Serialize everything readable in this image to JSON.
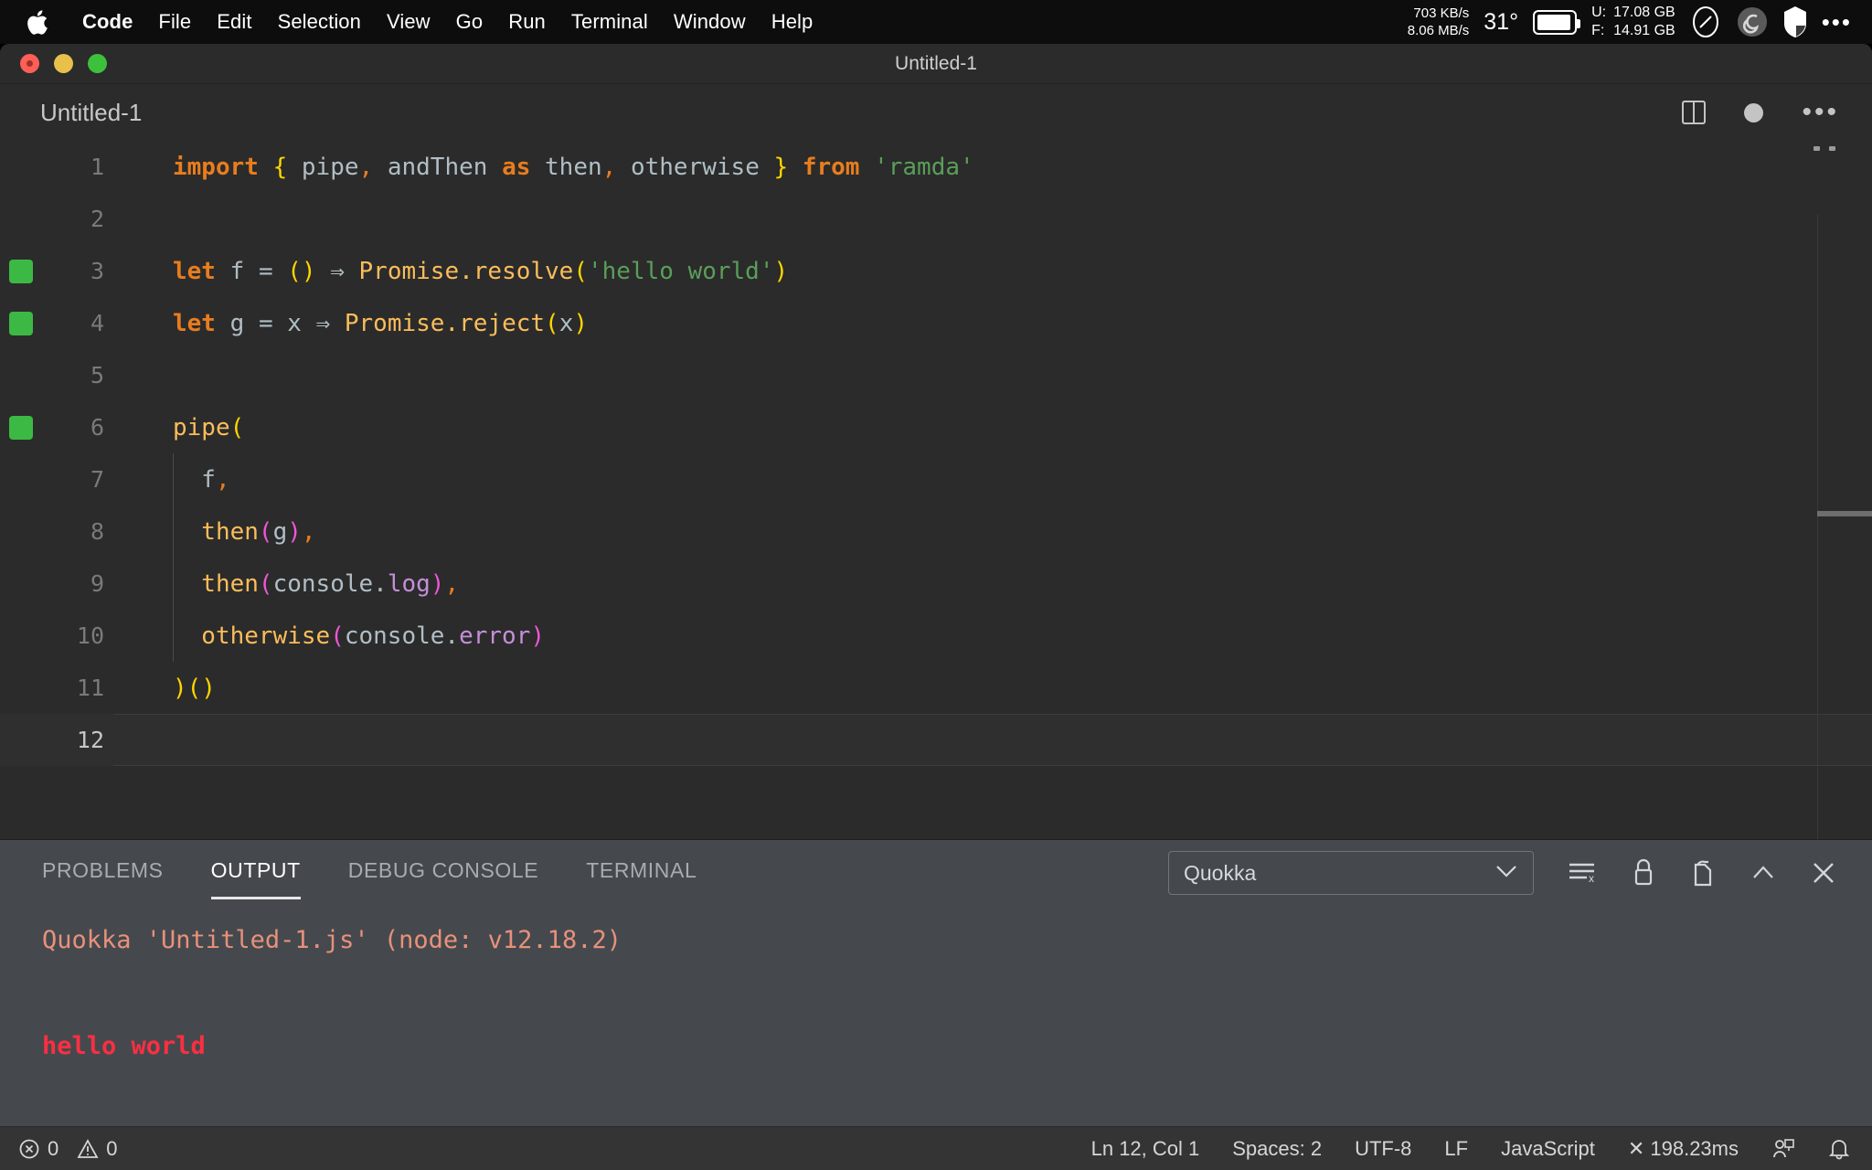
{
  "menubar": {
    "apple_icon": "apple-logo-icon",
    "items": [
      {
        "label": "Code",
        "bold": true
      },
      {
        "label": "File",
        "bold": false
      },
      {
        "label": "Edit",
        "bold": false
      },
      {
        "label": "Selection",
        "bold": false
      },
      {
        "label": "View",
        "bold": false
      },
      {
        "label": "Go",
        "bold": false
      },
      {
        "label": "Run",
        "bold": false
      },
      {
        "label": "Terminal",
        "bold": false
      },
      {
        "label": "Window",
        "bold": false
      },
      {
        "label": "Help",
        "bold": false
      }
    ],
    "status": {
      "net_up": "703 KB/s",
      "net_down": "8.06 MB/s",
      "temperature": "31°",
      "battery_icon": "battery-icon",
      "mem_used_label": "U:",
      "mem_used_value": "17.08 GB",
      "mem_free_label": "F:",
      "mem_free_value": "14.91 GB",
      "gauge_icon": "gauge-icon",
      "cleaner_icon": "spiral-icon",
      "shield_icon": "shield-icon",
      "more_icon": "ellipsis-icon"
    }
  },
  "window": {
    "title": "Untitled-1",
    "traffic": {
      "close": "close-button",
      "minimize": "minimize-button",
      "zoom": "zoom-button"
    }
  },
  "tabs": {
    "active_tab": "Untitled-1",
    "actions": {
      "split_editor": "split-editor-icon",
      "unsaved_dot": "unsaved-indicator-icon",
      "more": "more-actions-icon"
    }
  },
  "editor": {
    "language": "JavaScript",
    "colors": {
      "background": "#2b2b2b",
      "keyword": "#e87d1e",
      "string": "#5a9e5a",
      "function": "#fbbd5b",
      "property": "#c58fd8",
      "variable": "#b0bec5",
      "bracket_yellow": "#ffd500",
      "bracket_pink": "#ee56d6",
      "coverage_green": "#3cb944"
    },
    "lines": [
      {
        "n": "1",
        "coverage": false,
        "current": false,
        "tokens": [
          {
            "t": "import",
            "c": "t-kw"
          },
          {
            "t": " ",
            "c": "t-punc"
          },
          {
            "t": "{",
            "c": "t-brace"
          },
          {
            "t": " pipe",
            "c": "t-var"
          },
          {
            "t": ",",
            "c": "t-comma"
          },
          {
            "t": " andThen ",
            "c": "t-var"
          },
          {
            "t": "as",
            "c": "t-kw"
          },
          {
            "t": " then",
            "c": "t-var"
          },
          {
            "t": ",",
            "c": "t-comma"
          },
          {
            "t": " otherwise ",
            "c": "t-var"
          },
          {
            "t": "}",
            "c": "t-brace"
          },
          {
            "t": " ",
            "c": "t-punc"
          },
          {
            "t": "from",
            "c": "t-kw"
          },
          {
            "t": " ",
            "c": "t-punc"
          },
          {
            "t": "'ramda'",
            "c": "t-str"
          }
        ]
      },
      {
        "n": "2",
        "coverage": false,
        "current": false,
        "tokens": []
      },
      {
        "n": "3",
        "coverage": true,
        "current": false,
        "tokens": [
          {
            "t": "let",
            "c": "t-kw"
          },
          {
            "t": " f ",
            "c": "t-var"
          },
          {
            "t": "=",
            "c": "t-eq"
          },
          {
            "t": " ",
            "c": "t-punc"
          },
          {
            "t": "()",
            "c": "t-paren"
          },
          {
            "t": " ",
            "c": "t-punc"
          },
          {
            "t": "⇒",
            "c": "t-arrow"
          },
          {
            "t": " ",
            "c": "t-punc"
          },
          {
            "t": "Promise",
            "c": "t-fn"
          },
          {
            "t": ".",
            "c": "t-fn"
          },
          {
            "t": "resolve",
            "c": "t-fn"
          },
          {
            "t": "(",
            "c": "t-paren"
          },
          {
            "t": "'hello world'",
            "c": "t-str"
          },
          {
            "t": ")",
            "c": "t-paren"
          }
        ]
      },
      {
        "n": "4",
        "coverage": true,
        "current": false,
        "tokens": [
          {
            "t": "let",
            "c": "t-kw"
          },
          {
            "t": " g ",
            "c": "t-var"
          },
          {
            "t": "=",
            "c": "t-eq"
          },
          {
            "t": " x ",
            "c": "t-var"
          },
          {
            "t": "⇒",
            "c": "t-arrow"
          },
          {
            "t": " ",
            "c": "t-punc"
          },
          {
            "t": "Promise",
            "c": "t-fn"
          },
          {
            "t": ".",
            "c": "t-fn"
          },
          {
            "t": "reject",
            "c": "t-fn"
          },
          {
            "t": "(",
            "c": "t-paren"
          },
          {
            "t": "x",
            "c": "t-var"
          },
          {
            "t": ")",
            "c": "t-paren"
          }
        ]
      },
      {
        "n": "5",
        "coverage": false,
        "current": false,
        "tokens": []
      },
      {
        "n": "6",
        "coverage": true,
        "current": false,
        "tokens": [
          {
            "t": "pipe",
            "c": "t-fn"
          },
          {
            "t": "(",
            "c": "t-paren"
          }
        ]
      },
      {
        "n": "7",
        "coverage": false,
        "current": false,
        "tokens": [
          {
            "t": "  f",
            "c": "t-var"
          },
          {
            "t": ",",
            "c": "t-comma"
          }
        ]
      },
      {
        "n": "8",
        "coverage": false,
        "current": false,
        "tokens": [
          {
            "t": "  then",
            "c": "t-fn"
          },
          {
            "t": "(",
            "c": "t-paren2"
          },
          {
            "t": "g",
            "c": "t-var"
          },
          {
            "t": ")",
            "c": "t-paren2"
          },
          {
            "t": ",",
            "c": "t-comma"
          }
        ]
      },
      {
        "n": "9",
        "coverage": false,
        "current": false,
        "tokens": [
          {
            "t": "  then",
            "c": "t-fn"
          },
          {
            "t": "(",
            "c": "t-paren2"
          },
          {
            "t": "console",
            "c": "t-obj"
          },
          {
            "t": ".",
            "c": "t-obj"
          },
          {
            "t": "log",
            "c": "t-prop"
          },
          {
            "t": ")",
            "c": "t-paren2"
          },
          {
            "t": ",",
            "c": "t-comma"
          }
        ]
      },
      {
        "n": "10",
        "coverage": false,
        "current": false,
        "tokens": [
          {
            "t": "  otherwise",
            "c": "t-fn"
          },
          {
            "t": "(",
            "c": "t-paren2"
          },
          {
            "t": "console",
            "c": "t-obj"
          },
          {
            "t": ".",
            "c": "t-obj"
          },
          {
            "t": "error",
            "c": "t-prop"
          },
          {
            "t": ")",
            "c": "t-paren2"
          }
        ]
      },
      {
        "n": "11",
        "coverage": false,
        "current": false,
        "tokens": [
          {
            "t": ")",
            "c": "t-paren"
          },
          {
            "t": "()",
            "c": "t-paren"
          }
        ]
      },
      {
        "n": "12",
        "coverage": false,
        "current": true,
        "tokens": []
      }
    ]
  },
  "panel": {
    "tabs": [
      {
        "label": "PROBLEMS",
        "active": false
      },
      {
        "label": "OUTPUT",
        "active": true
      },
      {
        "label": "DEBUG CONSOLE",
        "active": false
      },
      {
        "label": "TERMINAL",
        "active": false
      }
    ],
    "channel_select": {
      "value": "Quokka",
      "caret": "chevron-down-icon"
    },
    "toolbar": {
      "clear_output": "clear-output-icon",
      "lock_scroll": "lock-icon",
      "open_in_editor": "open-in-editor-icon",
      "maximize": "chevron-up-icon",
      "close": "close-panel-icon"
    },
    "output": {
      "line1": "Quokka 'Untitled-1.js' (node: v12.18.2)",
      "line2": "hello world",
      "line1_color": "#e8917a",
      "line2_color": "#fa2f41"
    }
  },
  "statusbar": {
    "errors_icon": "error-circle-icon",
    "errors": "0",
    "warnings_icon": "warning-triangle-icon",
    "warnings": "0",
    "cursor_position": "Ln 12, Col 1",
    "indentation": "Spaces: 2",
    "encoding": "UTF-8",
    "eol": "LF",
    "language_mode": "JavaScript",
    "run_time": "✕ 198.23ms",
    "live_share_icon": "live-share-icon",
    "bell_icon": "bell-icon"
  }
}
